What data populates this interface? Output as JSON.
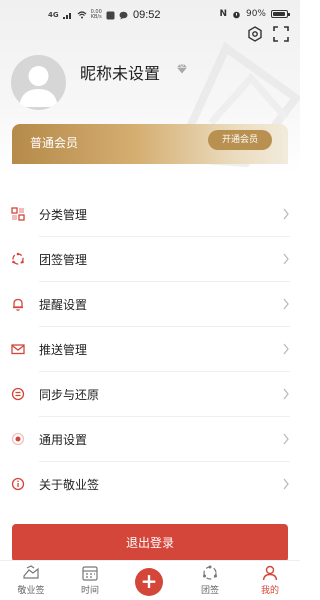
{
  "status_bar": {
    "signal": "4G",
    "rate_value": "0.00",
    "rate_unit": "KB/s",
    "time": "09:52",
    "nfc": "N",
    "battery": "90%",
    "battery_level": 0.9
  },
  "profile": {
    "nickname": "昵称未设置"
  },
  "membership": {
    "label": "普通会员",
    "button": "开通会员"
  },
  "menu": [
    {
      "label": "分类管理",
      "icon": "category-icon"
    },
    {
      "label": "团签管理",
      "icon": "group-sign-icon"
    },
    {
      "label": "提醒设置",
      "icon": "bell-icon"
    },
    {
      "label": "推送管理",
      "icon": "mail-icon"
    },
    {
      "label": "同步与还原",
      "icon": "sync-icon"
    },
    {
      "label": "通用设置",
      "icon": "general-settings-icon"
    },
    {
      "label": "关于敬业签",
      "icon": "info-icon"
    }
  ],
  "logout": {
    "label": "退出登录"
  },
  "bottom_nav": [
    {
      "label": "敬业签",
      "icon": "notes-icon",
      "active": false
    },
    {
      "label": "时间",
      "icon": "calendar-icon",
      "active": false
    },
    {
      "label": "",
      "icon": "add-icon",
      "active": false
    },
    {
      "label": "团签",
      "icon": "team-icon",
      "active": false
    },
    {
      "label": "我的",
      "icon": "person-icon",
      "active": true
    }
  ],
  "colors": {
    "accent": "#d4453a",
    "gold": "#b8904f",
    "text": "#222222"
  }
}
